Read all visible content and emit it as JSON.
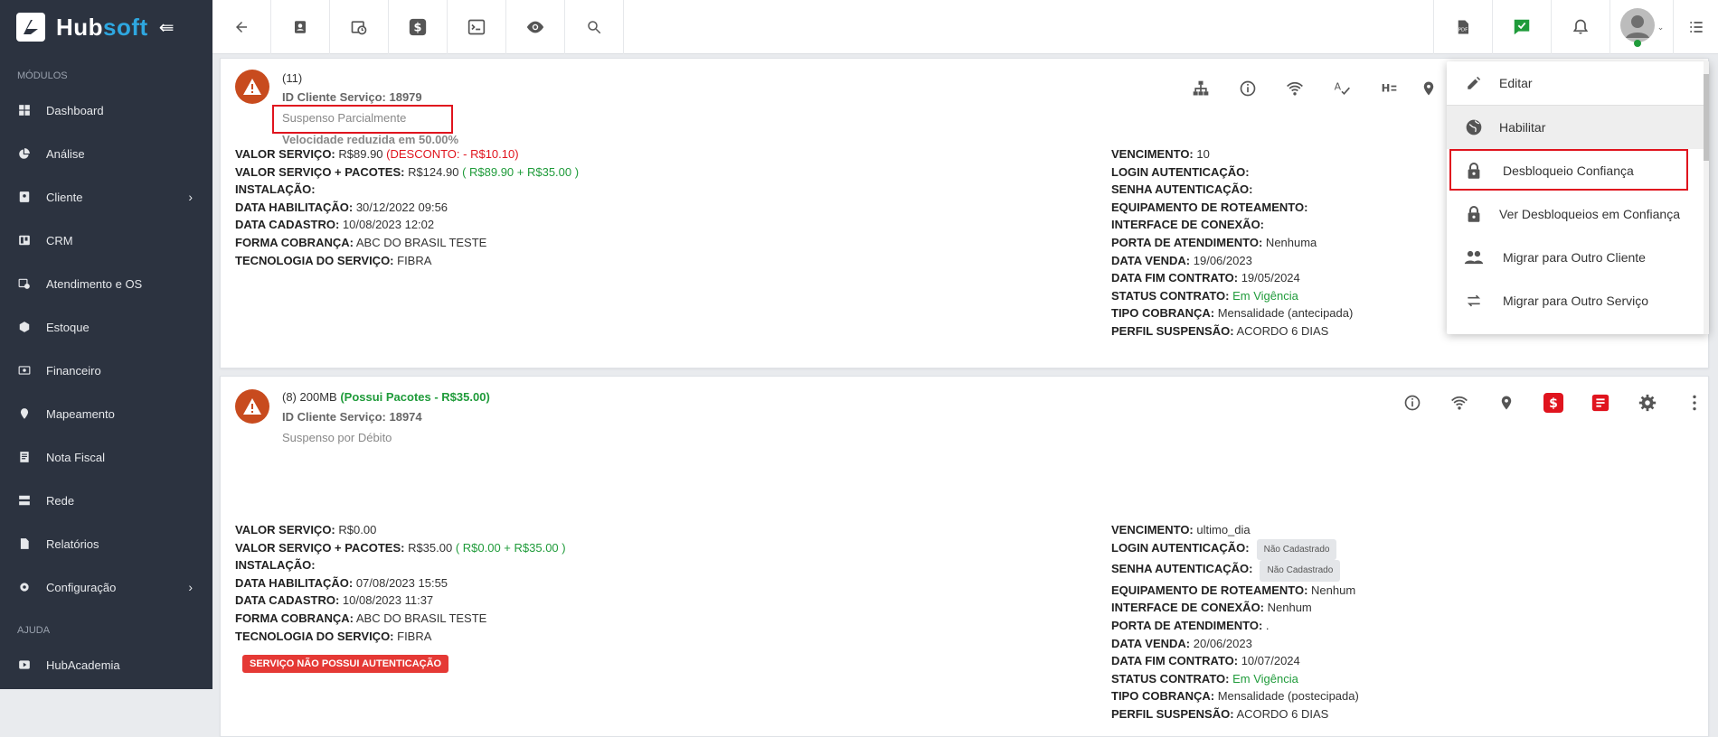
{
  "brand": {
    "name_part1": "Hub",
    "name_part2": "soft"
  },
  "sidebar": {
    "section_modules": "MÓDULOS",
    "section_help": "AJUDA",
    "items": [
      {
        "label": "Dashboard",
        "icon": "dashboard-icon"
      },
      {
        "label": "Análise",
        "icon": "pie-chart-icon"
      },
      {
        "label": "Cliente",
        "icon": "contact-card-icon",
        "has_children": true
      },
      {
        "label": "CRM",
        "icon": "kanban-icon"
      },
      {
        "label": "Atendimento e OS",
        "icon": "calendar-clock-icon"
      },
      {
        "label": "Estoque",
        "icon": "box-icon"
      },
      {
        "label": "Financeiro",
        "icon": "money-icon"
      },
      {
        "label": "Mapeamento",
        "icon": "map-pin-icon"
      },
      {
        "label": "Nota Fiscal",
        "icon": "receipt-icon"
      },
      {
        "label": "Rede",
        "icon": "server-icon"
      },
      {
        "label": "Relatórios",
        "icon": "file-icon"
      },
      {
        "label": "Configuração",
        "icon": "gear-icon",
        "has_children": true
      }
    ],
    "help_items": [
      {
        "label": "HubAcademia",
        "icon": "play-icon"
      }
    ]
  },
  "card1": {
    "title": "(11)",
    "id_line": "ID Cliente Serviço: 18979",
    "status": "Suspenso Parcialmente",
    "speed_note": "Velocidade reduzida em 50.00%",
    "left": [
      {
        "label": "VALOR SERVIÇO:",
        "value": " R$89.90 ",
        "extra": "(DESCONTO: - R$10.10)",
        "extra_color": "red"
      },
      {
        "label": "VALOR SERVIÇO + PACOTES:",
        "value": " R$124.90 ",
        "extra": "( R$89.90 + R$35.00 )",
        "extra_color": "green"
      },
      {
        "label": "INSTALAÇÃO:",
        "value": ""
      },
      {
        "label": "DATA HABILITAÇÃO:",
        "value": " 30/12/2022 09:56"
      },
      {
        "label": "DATA CADASTRO:",
        "value": " 10/08/2023 12:02"
      },
      {
        "label": "FORMA COBRANÇA:",
        "value": " ABC DO BRASIL TESTE"
      },
      {
        "label": "TECNOLOGIA DO SERVIÇO:",
        "value": " FIBRA"
      }
    ],
    "right": [
      {
        "label": "VENCIMENTO:",
        "value": " 10"
      },
      {
        "label": "LOGIN AUTENTICAÇÃO:",
        "value": ""
      },
      {
        "label": "SENHA AUTENTICAÇÃO:",
        "value": ""
      },
      {
        "label": "EQUIPAMENTO DE ROTEAMENTO:",
        "value": ""
      },
      {
        "label": "INTERFACE DE CONEXÃO:",
        "value": ""
      },
      {
        "label": "PORTA DE ATENDIMENTO:",
        "value": " Nenhuma"
      },
      {
        "label": "DATA VENDA:",
        "value": " 19/06/2023"
      },
      {
        "label": "DATA FIM CONTRATO:",
        "value": " 19/05/2024"
      },
      {
        "label": "STATUS CONTRATO:",
        "value": " Em Vigência",
        "color": "green"
      },
      {
        "label": "TIPO COBRANÇA:",
        "value": " Mensalidade (antecipada)"
      },
      {
        "label": "PERFIL SUSPENSÃO:",
        "value": " ACORDO 6 DIAS"
      }
    ]
  },
  "card2": {
    "title_prefix": "(8) 200MB ",
    "title_packages": "(Possui Pacotes - R$35.00)",
    "id_line": "ID Cliente Serviço: 18974",
    "status": "Suspenso por Débito",
    "auth_warning": "SERVIÇO NÃO POSSUI AUTENTICAÇÃO",
    "left": [
      {
        "label": "VALOR SERVIÇO:",
        "value": " R$0.00"
      },
      {
        "label": "VALOR SERVIÇO + PACOTES:",
        "value": " R$35.00 ",
        "extra": "( R$0.00 + R$35.00 )",
        "extra_color": "green"
      },
      {
        "label": "INSTALAÇÃO:",
        "value": ""
      },
      {
        "label": "DATA HABILITAÇÃO:",
        "value": " 07/08/2023 15:55"
      },
      {
        "label": "DATA CADASTRO:",
        "value": " 10/08/2023 11:37"
      },
      {
        "label": "FORMA COBRANÇA:",
        "value": " ABC DO BRASIL TESTE"
      },
      {
        "label": "TECNOLOGIA DO SERVIÇO:",
        "value": " FIBRA"
      }
    ],
    "right": [
      {
        "label": "VENCIMENTO:",
        "value": " ultimo_dia"
      },
      {
        "label": "LOGIN AUTENTICAÇÃO:",
        "value": "",
        "pill": "Não Cadastrado"
      },
      {
        "label": "SENHA AUTENTICAÇÃO:",
        "value": "",
        "pill": "Não Cadastrado"
      },
      {
        "label": "EQUIPAMENTO DE ROTEAMENTO:",
        "value": " Nenhum"
      },
      {
        "label": "INTERFACE DE CONEXÃO:",
        "value": " Nenhum"
      },
      {
        "label": "PORTA DE ATENDIMENTO:",
        "value": " ."
      },
      {
        "label": "DATA VENDA:",
        "value": " 20/06/2023"
      },
      {
        "label": "DATA FIM CONTRATO:",
        "value": " 10/07/2024"
      },
      {
        "label": "STATUS CONTRATO:",
        "value": " Em Vigência",
        "color": "green"
      },
      {
        "label": "TIPO COBRANÇA:",
        "value": " Mensalidade (postecipada)"
      },
      {
        "label": "PERFIL SUSPENSÃO:",
        "value": " ACORDO 6 DIAS"
      }
    ]
  },
  "dropdown": {
    "items": [
      {
        "label": "Editar",
        "icon": "pencil-icon"
      },
      {
        "label": "Habilitar",
        "icon": "globe-icon"
      },
      {
        "label": "Desbloqueio Confiança",
        "icon": "lock-icon"
      },
      {
        "label": "Ver Desbloqueios em Confiança",
        "icon": "lock-icon"
      },
      {
        "label": "Migrar para Outro Cliente",
        "icon": "people-icon"
      },
      {
        "label": "Migrar para Outro Serviço",
        "icon": "swap-icon"
      }
    ]
  },
  "colors": {
    "sidebar": "#2c3340",
    "accent": "#2ea7e0",
    "warning": "#c84b1e",
    "danger": "#e0141e",
    "success": "#1f9b3a"
  }
}
